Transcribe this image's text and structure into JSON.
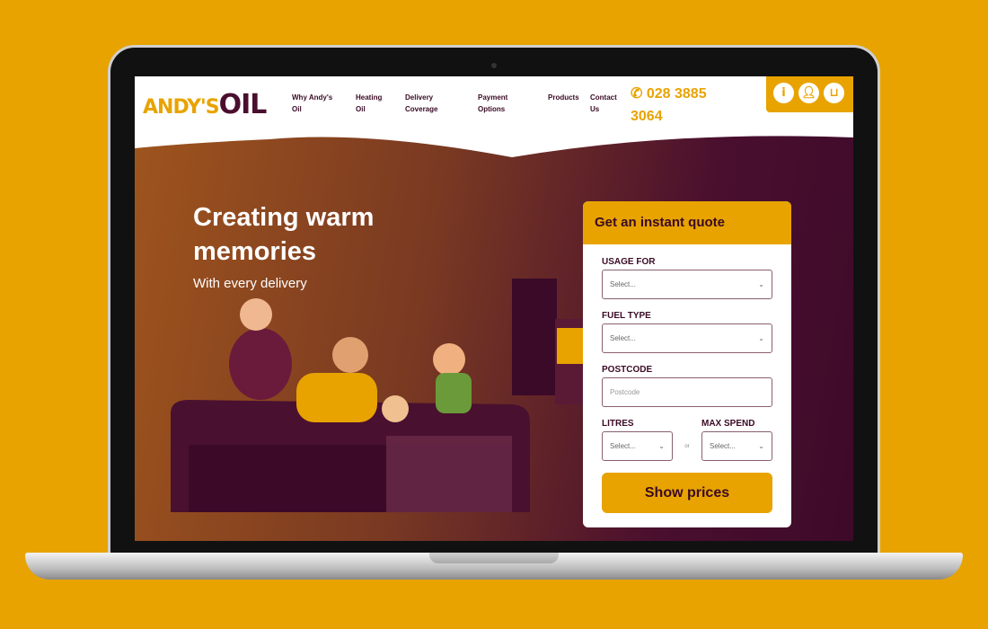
{
  "header": {
    "logo": {
      "part1": "ANDY'S",
      "part2": "OIL"
    },
    "nav": [
      {
        "label": "Why Andy's Oil"
      },
      {
        "label": "Heating Oil"
      },
      {
        "label": "Delivery Coverage"
      },
      {
        "label": "Payment Options"
      },
      {
        "label": "Products"
      },
      {
        "label": "Contact Us"
      }
    ],
    "phone": "028 3885 3064",
    "phone_icon": "phone-icon",
    "icons": [
      "info-icon",
      "user-icon",
      "basket-icon"
    ]
  },
  "hero": {
    "title": "Creating warm memories",
    "subtitle": "With every delivery"
  },
  "quote": {
    "title": "Get an instant quote",
    "usage": {
      "label": "USAGE FOR",
      "value": "Select..."
    },
    "fuel": {
      "label": "FUEL TYPE",
      "value": "Select..."
    },
    "postcode": {
      "label": "POSTCODE",
      "placeholder": "Postcode"
    },
    "litres": {
      "label": "LITRES",
      "value": "Select..."
    },
    "or": "or",
    "max_spend": {
      "label": "MAX SPEND",
      "value": "Select..."
    },
    "button": "Show prices"
  },
  "colors": {
    "brand_yellow": "#e8a300",
    "brand_purple": "#4a0f2e"
  }
}
